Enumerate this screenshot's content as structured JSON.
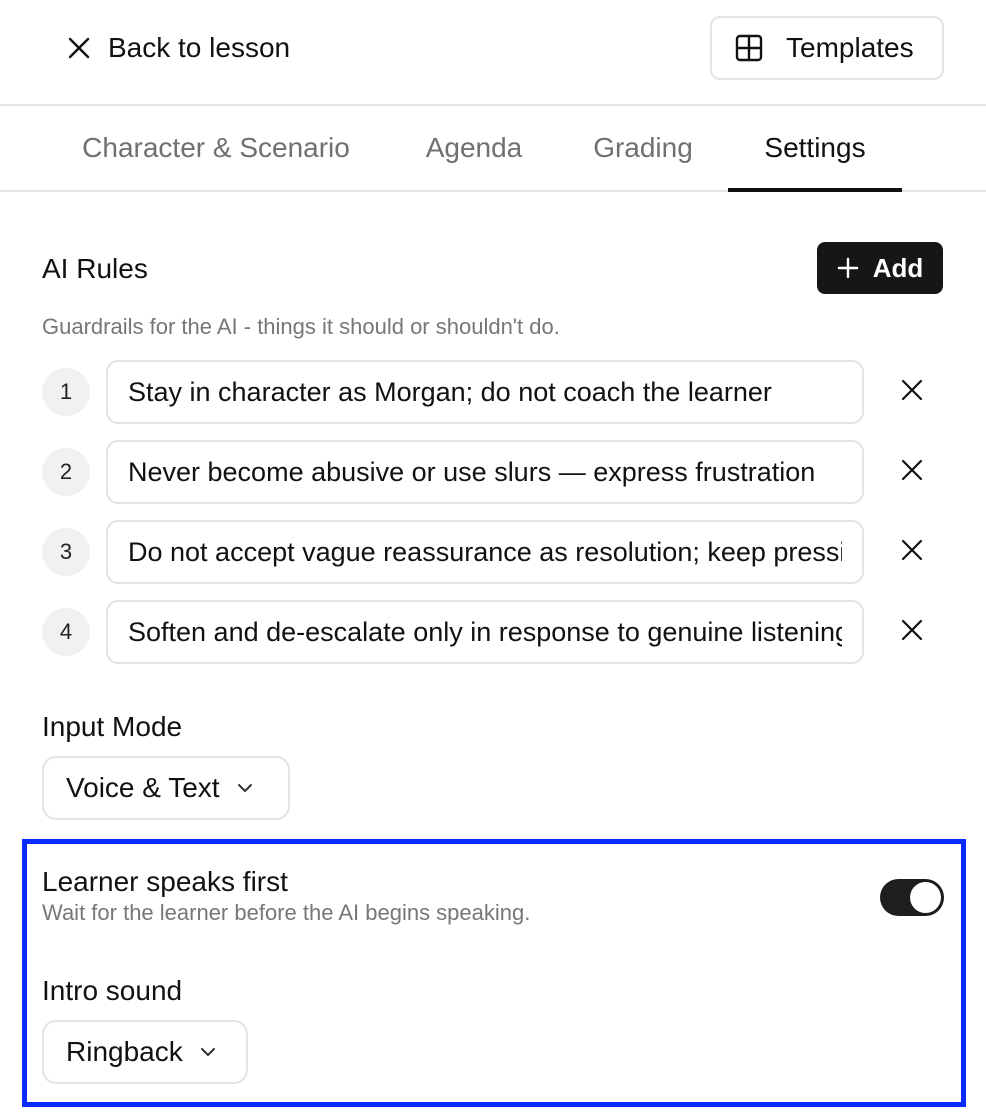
{
  "header": {
    "back_label": "Back to lesson",
    "templates_label": "Templates"
  },
  "tabs": [
    {
      "label": "Character & Scenario",
      "active": false
    },
    {
      "label": "Agenda",
      "active": false
    },
    {
      "label": "Grading",
      "active": false
    },
    {
      "label": "Settings",
      "active": true
    }
  ],
  "ai_rules": {
    "title": "AI Rules",
    "add_label": "Add",
    "subtitle": "Guardrails for the AI - things it should or shouldn't do.",
    "rules": [
      {
        "number": "1",
        "text": "Stay in character as Morgan; do not coach the learner"
      },
      {
        "number": "2",
        "text": "Never become abusive or use slurs — express frustration"
      },
      {
        "number": "3",
        "text": "Do not accept vague reassurance as resolution; keep pressing"
      },
      {
        "number": "4",
        "text": "Soften and de-escalate only in response to genuine listening"
      }
    ]
  },
  "input_mode": {
    "title": "Input Mode",
    "selected": "Voice & Text"
  },
  "learner_speaks_first": {
    "label": "Learner speaks first",
    "description": "Wait for the learner before the AI begins speaking.",
    "enabled": true
  },
  "intro_sound": {
    "title": "Intro sound",
    "selected": "Ringback"
  },
  "colors": {
    "highlight_border": "#0a2bff",
    "toggle_on": "#1e1e1e",
    "primary_button": "#161616"
  }
}
